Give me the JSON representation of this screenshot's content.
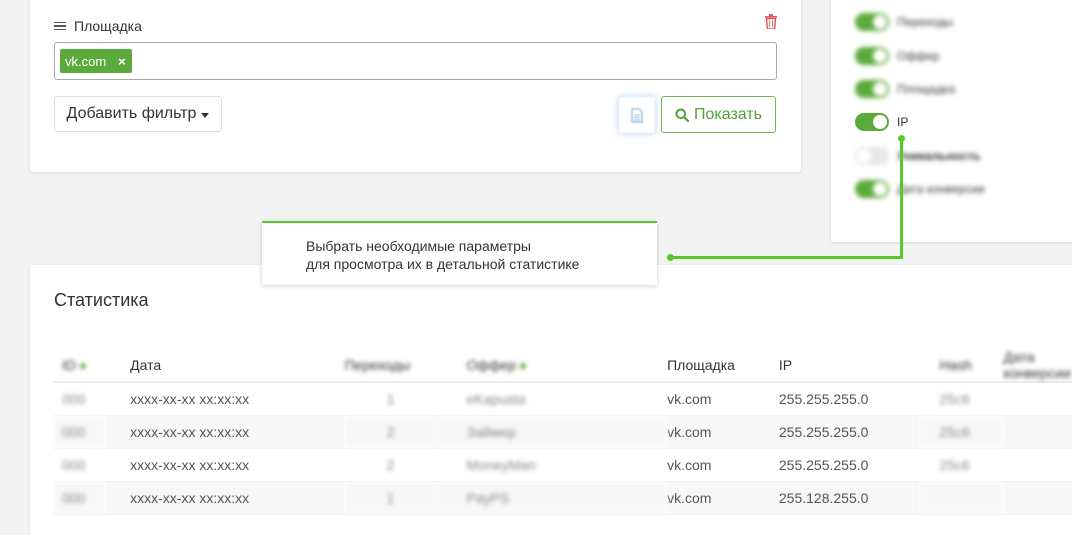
{
  "filter": {
    "label": "Площадка",
    "tag_value": "vk.com",
    "tag_remove": "×",
    "add_filter_label": "Добавить фильтр",
    "show_label": "Показать"
  },
  "columns_panel": {
    "toggles": [
      {
        "label": "Переходы",
        "on": true,
        "blurred": true
      },
      {
        "label": "Оффер",
        "on": true,
        "blurred": true
      },
      {
        "label": "Площадка",
        "on": true,
        "blurred": true
      },
      {
        "label": "IP",
        "on": true,
        "blurred": false
      },
      {
        "label": "Уникальность",
        "on": false,
        "blurred": true
      },
      {
        "label": "Дата конверсии",
        "on": true,
        "blurred": true
      }
    ]
  },
  "tooltip": {
    "line1": "Выбрать необходимые параметры",
    "line2": "для просмотра их в детальной статистике"
  },
  "stats": {
    "title": "Статистика",
    "headers": {
      "id": "ID",
      "date": "Дата",
      "transitions": "Переходы",
      "offer": "Оффер",
      "platform": "Площадка",
      "ip": "IP",
      "hash": "Hash",
      "conv_date": "Дата конверсии"
    },
    "rows": [
      {
        "id": "000",
        "date": "xxxx-xx-xx xx:xx:xx",
        "transitions": "1",
        "offer": "eKapusta",
        "platform": "vk.com",
        "ip": "255.255.255.0",
        "hash": "25c6"
      },
      {
        "id": "000",
        "date": "xxxx-xx-xx xx:xx:xx",
        "transitions": "2",
        "offer": "Займер",
        "platform": "vk.com",
        "ip": "255.255.255.0",
        "hash": "25c6"
      },
      {
        "id": "000",
        "date": "xxxx-xx-xx xx:xx:xx",
        "transitions": "2",
        "offer": "MoneyMan",
        "platform": "vk.com",
        "ip": "255.255.255.0",
        "hash": "25c6"
      },
      {
        "id": "000",
        "date": "xxxx-xx-xx xx:xx:xx",
        "transitions": "1",
        "offer": "PayPS",
        "platform": "vk.com",
        "ip": "255.128.255.0",
        "hash": ""
      }
    ]
  },
  "colors": {
    "accent": "#5daa3c",
    "connector": "#5ac82d",
    "danger": "#e05c5c"
  },
  "icons": [
    "menu-icon",
    "trash-icon",
    "close-icon",
    "caret-down-icon",
    "document-icon",
    "search-icon"
  ]
}
